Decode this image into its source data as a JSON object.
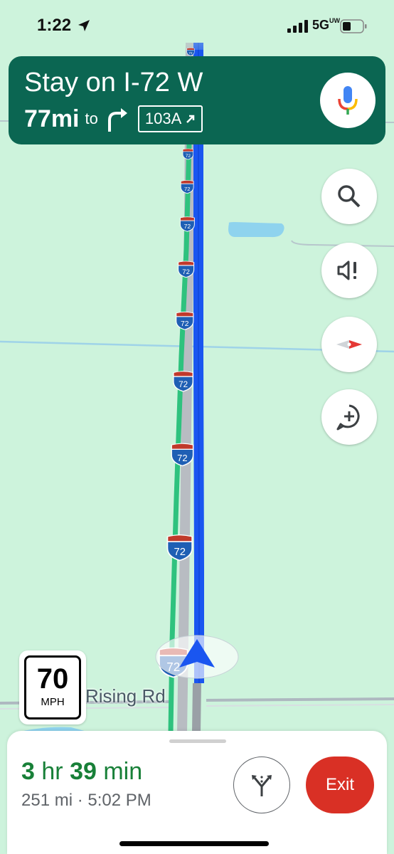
{
  "status_bar": {
    "time": "1:22",
    "network": "5G",
    "network_suffix": "UW"
  },
  "navigation": {
    "instruction": "Stay on I-72 W",
    "distance": "77mi",
    "to_label": "to",
    "exit_label": "103A"
  },
  "map": {
    "highway_shield": "72",
    "road_name": "Rising Rd",
    "route_color": "#1a56f0",
    "alternate_route_color": "#2ec27e"
  },
  "speed_limit": {
    "value": "70",
    "unit": "MPH"
  },
  "trip": {
    "eta_hours": "3",
    "hours_unit": "hr",
    "eta_minutes": "39",
    "minutes_unit": "min",
    "distance": "251 mi",
    "separator": "·",
    "arrival_time": "5:02 PM"
  },
  "buttons": {
    "exit_label": "Exit",
    "icons": [
      "mic-icon",
      "search-icon",
      "mute-alert-icon",
      "compass-icon",
      "add-report-icon",
      "alternate-routes-icon"
    ]
  },
  "colors": {
    "banner": "#0b6652",
    "eta": "#188038",
    "exit_button": "#d93025",
    "map_background": "#cdf3dc"
  }
}
